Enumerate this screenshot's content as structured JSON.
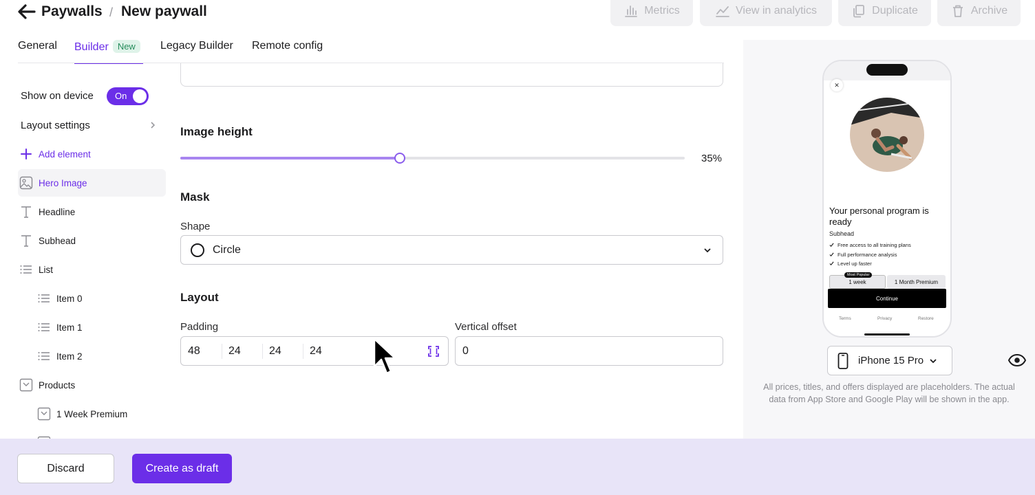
{
  "header": {
    "breadcrumb_root": "Paywalls",
    "breadcrumb_sep": "/",
    "title": "New paywall",
    "actions": {
      "metrics": "Metrics",
      "analytics": "View in analytics",
      "duplicate": "Duplicate",
      "archive": "Archive"
    }
  },
  "tabs": {
    "general": "General",
    "builder": "Builder",
    "builder_badge": "New",
    "legacy": "Legacy Builder",
    "remote": "Remote config"
  },
  "sidebar": {
    "show_on_device": "Show on device",
    "toggle_label": "On",
    "layout_settings": "Layout settings",
    "add_element": "Add element",
    "items": {
      "hero_image": "Hero Image",
      "headline": "Headline",
      "subhead": "Subhead",
      "list": "List",
      "item0": "Item 0",
      "item1": "Item 1",
      "item2": "Item 2",
      "products": "Products",
      "week_premium": "1 Week Premium"
    }
  },
  "editor": {
    "image_height_title": "Image height",
    "image_height_value": "35%",
    "image_height_fraction": 0.435,
    "mask_title": "Mask",
    "shape_label": "Shape",
    "shape_value": "Circle",
    "layout_title": "Layout",
    "padding_label": "Padding",
    "padding": [
      "48",
      "24",
      "24",
      "24"
    ],
    "vertical_offset_label": "Vertical offset",
    "vertical_offset_value": "0"
  },
  "preview": {
    "headline": "Your personal program is ready",
    "subhead": "Subhead",
    "list": [
      "Free access to all training plans",
      "Full performance analysis",
      "Level up faster"
    ],
    "badge": "Most Popular",
    "product_1": "1 week",
    "product_2": "1 Month Premium",
    "cta": "Continue",
    "footer": [
      "Terms",
      "Privacy",
      "Restore"
    ],
    "device": "iPhone 15 Pro",
    "disclaimer": "All prices, titles, and offers displayed are placeholders. The actual data from App Store and Google Play will be shown in the app."
  },
  "footer": {
    "discard": "Discard",
    "create": "Create as draft"
  },
  "colors": {
    "accent": "#6b2ee8",
    "footer_bg": "#e8e4f8",
    "badge_bg": "#dff3e9",
    "badge_text": "#268c5b"
  }
}
